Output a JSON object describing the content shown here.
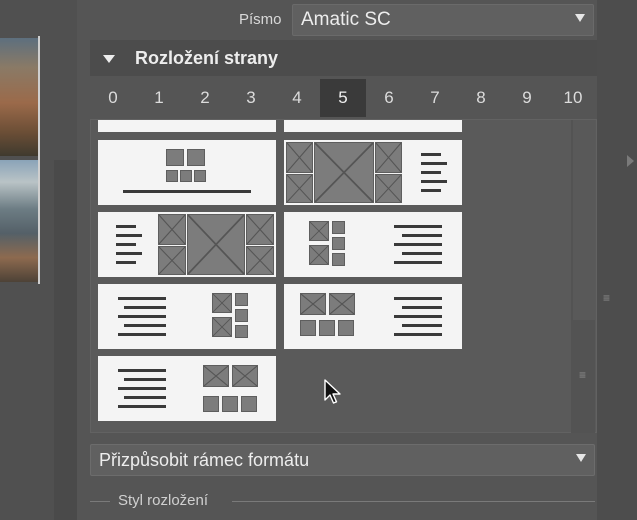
{
  "font_row": {
    "label": "Písmo",
    "value": "Amatic SC"
  },
  "section": {
    "title": "Rozložení strany"
  },
  "tabs": [
    {
      "label": "0"
    },
    {
      "label": "1"
    },
    {
      "label": "2"
    },
    {
      "label": "3"
    },
    {
      "label": "4"
    },
    {
      "label": "5"
    },
    {
      "label": "6"
    },
    {
      "label": "7"
    },
    {
      "label": "8"
    },
    {
      "label": "9"
    },
    {
      "label": "10"
    }
  ],
  "active_tab": "5",
  "format_select": {
    "value": "Přizpůsobit rámec formátu"
  },
  "subsection": {
    "title": "Styl rozložení"
  },
  "colors": {
    "panel_bg": "#555555",
    "header_bg": "#4c4c4c",
    "active_tab_bg": "#3a3a3a",
    "card_bg": "#f4f4f4",
    "placeholder": "#7c7c7c"
  }
}
